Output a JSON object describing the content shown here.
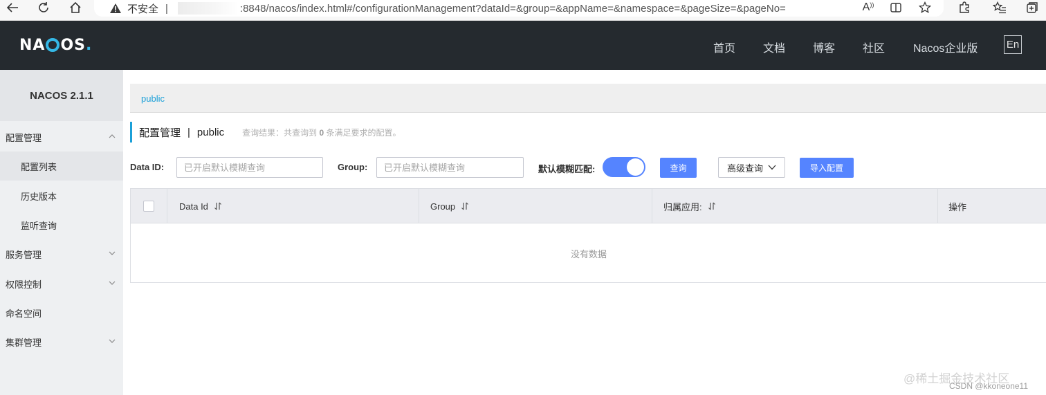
{
  "browser": {
    "insecure_label": "不安全",
    "separator": "|",
    "url_visible": ":8848/nacos/index.html#/configurationManagement?dataId=&group=&appName=&namespace=&pageSize=&pageNo=",
    "read_aloud_glyph": "A"
  },
  "header": {
    "logo_part1": "NA",
    "logo_part2": "OS",
    "logo_dot": ".",
    "nav": [
      "首页",
      "文档",
      "博客",
      "社区",
      "Nacos企业版"
    ],
    "lang_button": "En"
  },
  "sidebar": {
    "version_title": "NACOS 2.1.1",
    "items": [
      {
        "label": "配置管理",
        "level": 0,
        "expanded": true
      },
      {
        "label": "配置列表",
        "level": 1
      },
      {
        "label": "历史版本",
        "level": 1
      },
      {
        "label": "监听查询",
        "level": 1
      },
      {
        "label": "服务管理",
        "level": 0,
        "expanded": false
      },
      {
        "label": "权限控制",
        "level": 0,
        "expanded": false
      },
      {
        "label": "命名空间",
        "level": 0
      },
      {
        "label": "集群管理",
        "level": 0,
        "expanded": false
      }
    ]
  },
  "main": {
    "breadcrumb_namespace": "public",
    "heading_title": "配置管理",
    "heading_sep": "|",
    "heading_namespace": "public",
    "result_prefix": "查询结果：共查询到",
    "result_count": "0",
    "result_suffix": "条满足要求的配置。",
    "filters": {
      "data_id_label": "Data ID:",
      "data_id_placeholder": "已开启默认模糊查询",
      "data_id_value": "",
      "group_label": "Group:",
      "group_placeholder": "已开启默认模糊查询",
      "group_value": "",
      "fuzzy_label": "默认模糊匹配:",
      "fuzzy_enabled": true,
      "query_button": "查询",
      "advanced_button": "高级查询",
      "import_button": "导入配置"
    },
    "table": {
      "columns": [
        "Data Id",
        "Group",
        "归属应用:",
        "操作"
      ],
      "rows": [],
      "empty_text": "没有数据"
    }
  },
  "watermark": {
    "main": "@稀土掘金技术社区",
    "sub": "CSDN @kkoneone11"
  },
  "colors": {
    "header_bg": "#252a2f",
    "accent_blue": "#5584ff",
    "link_blue": "#1ba0d8",
    "sidebar_bg": "#eef0f2"
  }
}
